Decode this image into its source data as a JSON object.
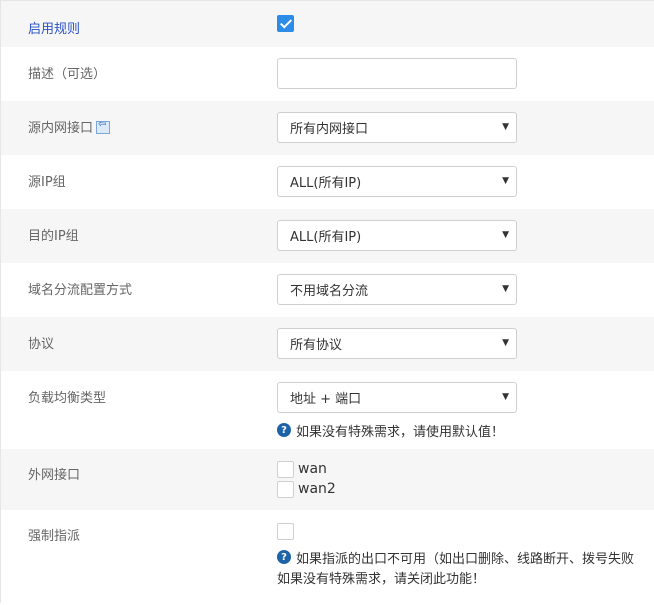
{
  "rows": {
    "enable": {
      "label": "启用规则",
      "checked": true
    },
    "description": {
      "label": "描述（可选）",
      "value": "",
      "placeholder": ""
    },
    "src_iface": {
      "label": "源内网接口",
      "icon": "back-arrow-icon",
      "selected": "所有内网接口"
    },
    "src_ip": {
      "label": "源IP组",
      "selected": "ALL(所有IP)"
    },
    "dst_ip": {
      "label": "目的IP组",
      "selected": "ALL(所有IP)"
    },
    "domain_mode": {
      "label": "域名分流配置方式",
      "selected": "不用域名分流"
    },
    "protocol": {
      "label": "协议",
      "selected": "所有协议"
    },
    "lb_type": {
      "label": "负载均衡类型",
      "selected": "地址 + 端口",
      "hint": "如果没有特殊需求，请使用默认值！"
    },
    "wan": {
      "label": "外网接口",
      "options": [
        "wan",
        "wan2"
      ]
    },
    "force": {
      "label": "强制指派",
      "hint_line1": "如果指派的出口不可用（如出口删除、线路断开、拨号失败",
      "hint_line2": "如果没有特殊需求，请关闭此功能！"
    }
  },
  "colors": {
    "accent": "#2d8ce7",
    "label_active": "#2b53c4",
    "help_icon": "#1e63a8"
  }
}
